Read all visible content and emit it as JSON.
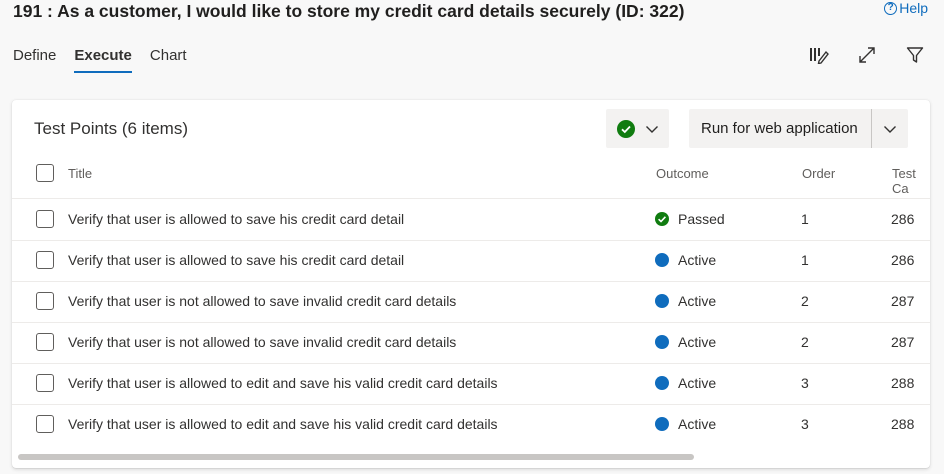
{
  "header": {
    "title": "191 : As a customer, I would like to store my credit card details securely (ID: 322)",
    "help_label": "Help",
    "help_icon": "help-circle-icon"
  },
  "tabs": [
    {
      "label": "Define",
      "active": false
    },
    {
      "label": "Execute",
      "active": true
    },
    {
      "label": "Chart",
      "active": false
    }
  ],
  "toolbar": {
    "icons": [
      "column-options-icon",
      "expand-icon",
      "filter-icon"
    ]
  },
  "panel": {
    "title": "Test Points (6 items)",
    "outcome_icon": "check-circle-icon",
    "run_label": "Run for web application"
  },
  "columns": {
    "title": "Title",
    "outcome": "Outcome",
    "order": "Order",
    "test_case": "Test Ca"
  },
  "rows": [
    {
      "title": "Verify that user is allowed to save his credit card detail",
      "outcome": "Passed",
      "order": "1",
      "test_case": "286"
    },
    {
      "title": "Verify that user is allowed to save his credit card detail",
      "outcome": "Active",
      "order": "1",
      "test_case": "286"
    },
    {
      "title": "Verify that user is not allowed to save invalid credit card details",
      "outcome": "Active",
      "order": "2",
      "test_case": "287"
    },
    {
      "title": "Verify that user is not allowed to save invalid credit card details",
      "outcome": "Active",
      "order": "2",
      "test_case": "287"
    },
    {
      "title": "Verify that user is allowed to edit and save his valid credit card details",
      "outcome": "Active",
      "order": "3",
      "test_case": "288"
    },
    {
      "title": "Verify that user is allowed to edit and save his valid credit card details",
      "outcome": "Active",
      "order": "3",
      "test_case": "288"
    }
  ],
  "colors": {
    "accent": "#0f6cbd",
    "passed": "#107c10",
    "active": "#0f6cbd"
  }
}
